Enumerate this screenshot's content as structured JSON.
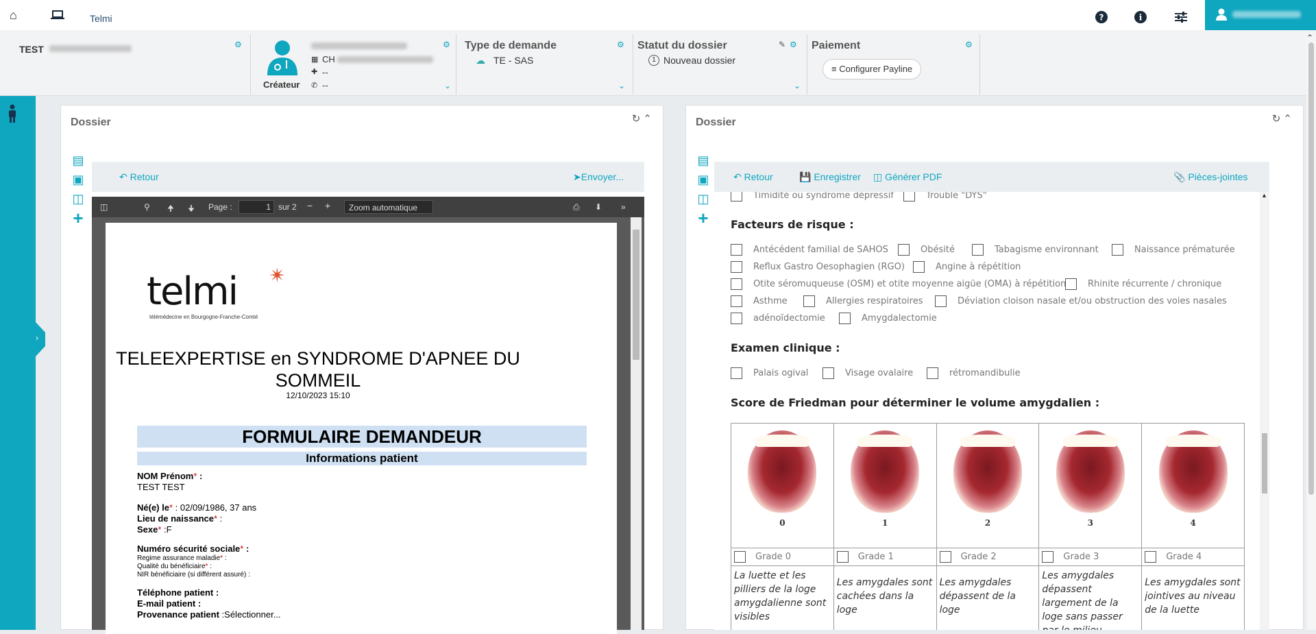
{
  "topnav": {
    "brand": "Telmi",
    "icons": [
      "home-icon",
      "laptop-icon",
      "help-icon",
      "info-icon",
      "sliders-icon",
      "user-icon"
    ]
  },
  "header": {
    "patient": {
      "name": "TEST"
    },
    "creator": {
      "facility": "CH",
      "phone1": "--",
      "phone2": "--",
      "role": "Créateur"
    },
    "request_type": {
      "title": "Type de demande",
      "value": "TE - SAS"
    },
    "status": {
      "title": "Statut du dossier",
      "step": "1",
      "value": "Nouveau dossier"
    },
    "payment": {
      "title": "Paiement",
      "button": "Configurer Payline"
    }
  },
  "left_panel": {
    "title": "Dossier",
    "back": "Retour",
    "send": "Envoyer...",
    "pdf_toolbar": {
      "page_label": "Page :",
      "page": "1",
      "of": "sur 2",
      "zoom": "Zoom automatique"
    },
    "pdf": {
      "logo": "telmi",
      "logo_sub": "télémédecine en Bourgogne-Franche-Comté",
      "title_line1": "TELEEXPERTISE en SYNDROME D'APNEE DU",
      "title_line2": "SOMMEIL",
      "datetime": "12/10/2023 15:10",
      "form_title": "FORMULAIRE DEMANDEUR",
      "section": "Informations patient",
      "nom_label": "NOM Prénom",
      "nom_value": "TEST   TEST",
      "dob_label": "Né(e) le",
      "dob_value": " : 02/09/1986, 37 ans",
      "lieu_label": "Lieu de naissance",
      "sexe_label": "Sexe",
      "sexe_value": " :F",
      "nss_label": "Numéro sécurité sociale",
      "regime": "Regime assurance maladie",
      "qualite": "Qualité du bénéficiaire",
      "nir": "NIR bénéficiaire (si différent assuré) :",
      "tel": "Téléphone patient :",
      "email": "E-mail patient :",
      "prov_label": "Provenance patient",
      "prov_value": " :Sélectionner..."
    }
  },
  "right_panel": {
    "title": "Dossier",
    "back": "Retour",
    "save": "Enregistrer",
    "pdf": "Générer PDF",
    "attachments": "Pièces-jointes",
    "prev_items": [
      "Timidité ou syndrome dépressif",
      "Trouble \"DYS\""
    ],
    "risk_title": "Facteurs de risque :",
    "risk_rows": [
      [
        "Antécédent familial de SAHOS",
        "Obésité",
        "Tabagisme environnant",
        "Naissance prématurée"
      ],
      [
        "Reflux Gastro Oesophagien (RGO)",
        "Angine à répétition"
      ],
      [
        "Otite séromuqueuse (OSM) et otite moyenne aigüe (OMA) à répétition",
        "Rhinite récurrente / chronique"
      ],
      [
        "Asthme",
        "Allergies respiratoires",
        "Déviation cloison nasale et/ou obstruction des voies nasales"
      ],
      [
        "adénoïdectomie",
        "Amygdalectomie"
      ]
    ],
    "exam_title": "Examen clinique :",
    "exam_items": [
      "Palais ogival",
      "Visage ovalaire",
      "rétromandibulie"
    ],
    "friedman_title": "Score de Friedman pour déterminer le volume amygdalien :",
    "grades": [
      {
        "num": "0",
        "label": "Grade 0",
        "desc": "La luette et les pilliers de la loge amygdalienne sont visibles"
      },
      {
        "num": "1",
        "label": "Grade 1",
        "desc": "Les amygdales sont cachées dans la loge"
      },
      {
        "num": "2",
        "label": "Grade 2",
        "desc": "Les amygdales dépassent de la loge"
      },
      {
        "num": "3",
        "label": "Grade 3",
        "desc": "Les amygdales dépassent largement de la loge sans passer par le milieu"
      },
      {
        "num": "4",
        "label": "Grade 4",
        "desc": "Les amygdales sont jointives au niveau de la luette"
      }
    ]
  }
}
